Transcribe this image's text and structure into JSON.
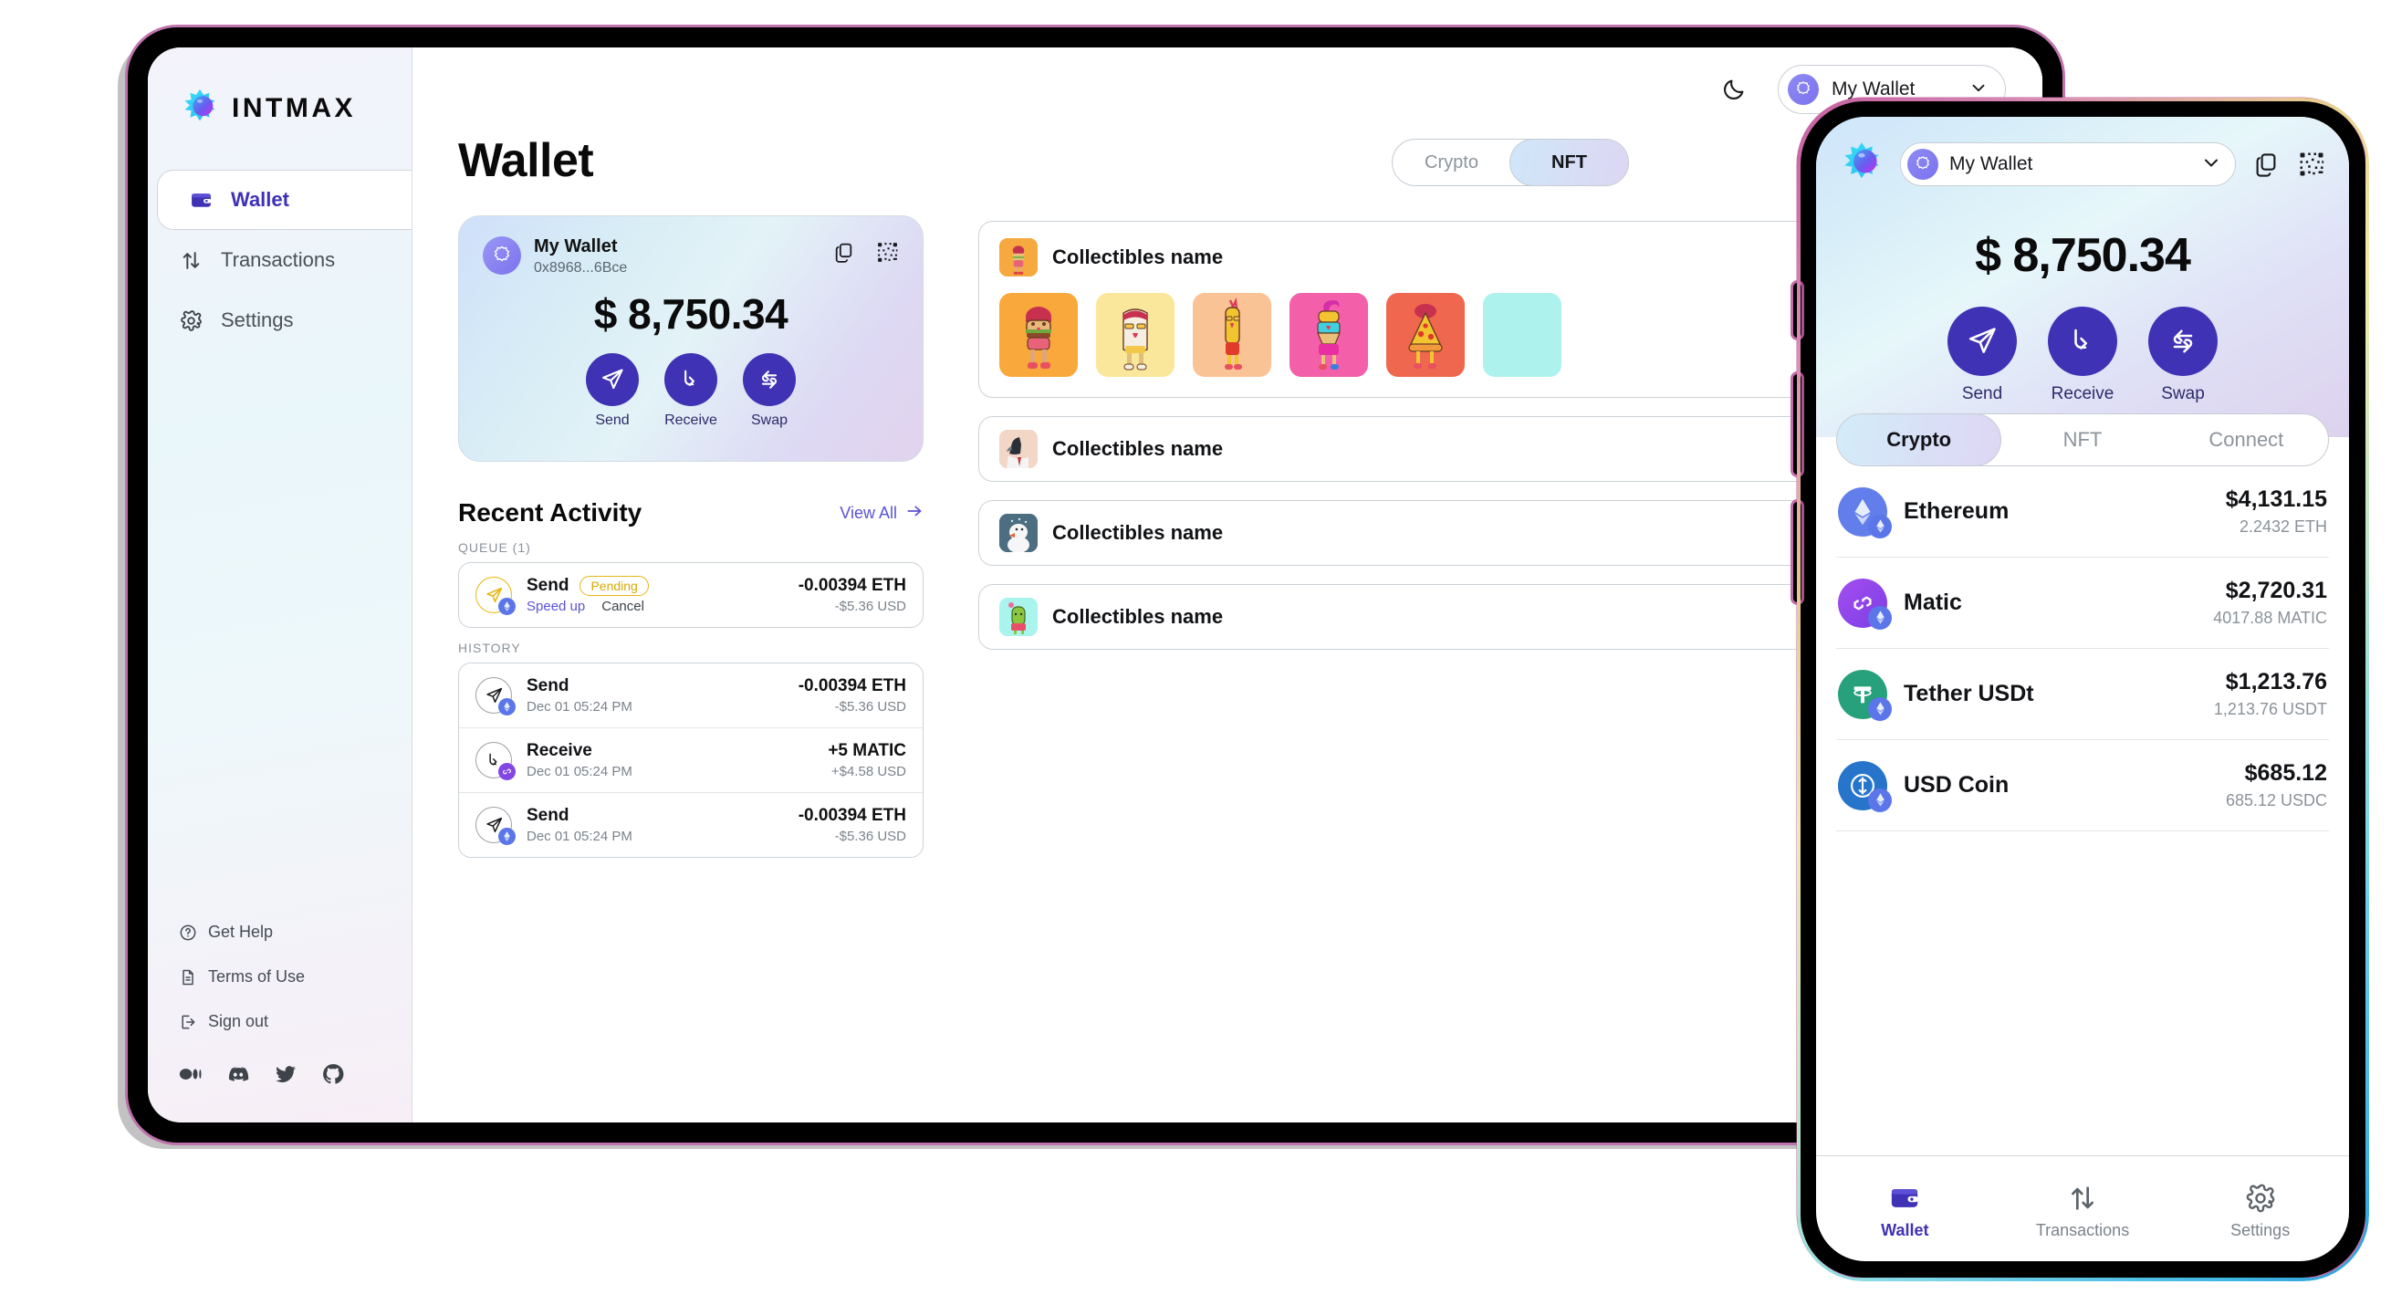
{
  "brand": {
    "name": "INTMAX",
    "logo_icon": "intmax-logo-icon"
  },
  "sidebar": {
    "nav": [
      {
        "label": "Wallet",
        "icon": "wallet-icon",
        "active": true
      },
      {
        "label": "Transactions",
        "icon": "transactions-arrows-icon",
        "active": false
      },
      {
        "label": "Settings",
        "icon": "gear-icon",
        "active": false
      }
    ],
    "footer_links": [
      {
        "label": "Get Help",
        "icon": "question-circle-icon"
      },
      {
        "label": "Terms of Use",
        "icon": "document-icon"
      },
      {
        "label": "Sign out",
        "icon": "sign-out-icon"
      }
    ],
    "socials": [
      "medium-icon",
      "discord-icon",
      "twitter-icon",
      "github-icon"
    ]
  },
  "header": {
    "theme_toggle_icon": "moon-icon",
    "wallet_selector": {
      "label": "My Wallet",
      "chevron_icon": "chevron-down-icon",
      "avatar_icon": "starburst-avatar-icon"
    }
  },
  "page": {
    "title": "Wallet"
  },
  "balance_card": {
    "wallet_name": "My Wallet",
    "address": "0x8968...6Bce",
    "copy_icon": "copy-icon",
    "qr_icon": "qr-code-icon",
    "balance": "$ 8,750.34",
    "actions": [
      {
        "label": "Send",
        "icon": "send-paper-plane-icon"
      },
      {
        "label": "Receive",
        "icon": "receive-arrow-down-icon"
      },
      {
        "label": "Swap",
        "icon": "swap-arrows-icon"
      }
    ]
  },
  "recent_activity": {
    "title": "Recent Activity",
    "view_all": "View All",
    "view_all_icon": "arrow-right-icon",
    "queue_label": "QUEUE (1)",
    "history_label": "HISTORY",
    "queue": [
      {
        "type": "Send",
        "icon": "send-paper-plane-icon",
        "chain": "eth",
        "chain_icon": "ethereum-icon",
        "status": "Pending",
        "speed_up": "Speed up",
        "cancel": "Cancel",
        "amount": "-0.00394 ETH",
        "usd": "-$5.36 USD"
      }
    ],
    "history": [
      {
        "type": "Send",
        "icon": "send-paper-plane-icon",
        "chain": "eth",
        "chain_icon": "ethereum-icon",
        "date": "Dec 01 05:24 PM",
        "amount": "-0.00394 ETH",
        "usd": "-$5.36 USD"
      },
      {
        "type": "Receive",
        "icon": "receive-arrow-down-icon",
        "chain": "matic",
        "chain_icon": "polygon-icon",
        "date": "Dec 01 05:24 PM",
        "amount": "+5 MATIC",
        "usd": "+$4.58 USD"
      },
      {
        "type": "Send",
        "icon": "send-paper-plane-icon",
        "chain": "eth",
        "chain_icon": "ethereum-icon",
        "date": "Dec 01 05:24 PM",
        "amount": "-0.00394 ETH",
        "usd": "-$5.36 USD"
      }
    ]
  },
  "asset_tabs": {
    "options": [
      "Crypto",
      "NFT"
    ],
    "selected": "NFT"
  },
  "collectibles": {
    "groups": [
      {
        "name": "Collectibles name",
        "thumb_color": "#f6a93f",
        "tiles": [
          {
            "bg": "#f9a83c",
            "art": "burger-character"
          },
          {
            "bg": "#fbe79b",
            "art": "toast-character"
          },
          {
            "bg": "#f9c396",
            "art": "fries-character"
          },
          {
            "bg": "#f45fa9",
            "art": "icecream-character"
          },
          {
            "bg": "#f0674f",
            "art": "pizza-character"
          },
          {
            "bg": "#aef2ee",
            "art": "mint-character"
          }
        ]
      }
    ],
    "rows": [
      {
        "name": "Collectibles name",
        "thumb_color": "#f0d0c0",
        "art": "crow-character"
      },
      {
        "name": "Collectibles name",
        "thumb_color": "#4c6e80",
        "art": "snowman-character"
      },
      {
        "name": "Collectibles name",
        "thumb_color": "#aaf4ee",
        "art": "cactus-character"
      }
    ]
  },
  "phone": {
    "logo_icon": "intmax-mark-icon",
    "wallet_selector": {
      "label": "My Wallet",
      "chevron_icon": "chevron-down-icon",
      "avatar_icon": "starburst-avatar-icon"
    },
    "copy_icon": "copy-icon",
    "qr_icon": "qr-code-icon",
    "balance": "$ 8,750.34",
    "actions": [
      {
        "label": "Send",
        "icon": "send-paper-plane-icon"
      },
      {
        "label": "Receive",
        "icon": "receive-arrow-down-icon"
      },
      {
        "label": "Swap",
        "icon": "swap-arrows-icon"
      }
    ],
    "tabs": {
      "options": [
        "Crypto",
        "NFT",
        "Connect"
      ],
      "selected": "Crypto"
    },
    "tokens": [
      {
        "name": "Ethereum",
        "usd": "$4,131.15",
        "amount": "2.2432 ETH",
        "icon": "ethereum-icon",
        "color": "#627eea",
        "chain_icon": "ethereum-icon"
      },
      {
        "name": "Matic",
        "usd": "$2,720.31",
        "amount": "4017.88 MATIC",
        "icon": "polygon-icon",
        "color": "#8247e5",
        "chain_icon": "ethereum-icon"
      },
      {
        "name": "Tether USDt",
        "usd": "$1,213.76",
        "amount": "1,213.76 USDT",
        "icon": "tether-icon",
        "color": "#26a17b",
        "chain_icon": "ethereum-icon"
      },
      {
        "name": "USD Coin",
        "usd": "$685.12",
        "amount": "685.12 USDC",
        "icon": "usdc-icon",
        "color": "#2775ca",
        "chain_icon": "ethereum-icon"
      }
    ],
    "bottom_nav": [
      {
        "label": "Wallet",
        "icon": "wallet-icon",
        "active": true
      },
      {
        "label": "Transactions",
        "icon": "transactions-arrows-icon",
        "active": false
      },
      {
        "label": "Settings",
        "icon": "gear-icon",
        "active": false
      }
    ]
  },
  "colors": {
    "accent_purple": "#3f32b5",
    "link_purple": "#5b53d6",
    "pending_yellow": "#e8b713",
    "muted_gray": "#8b929a"
  }
}
